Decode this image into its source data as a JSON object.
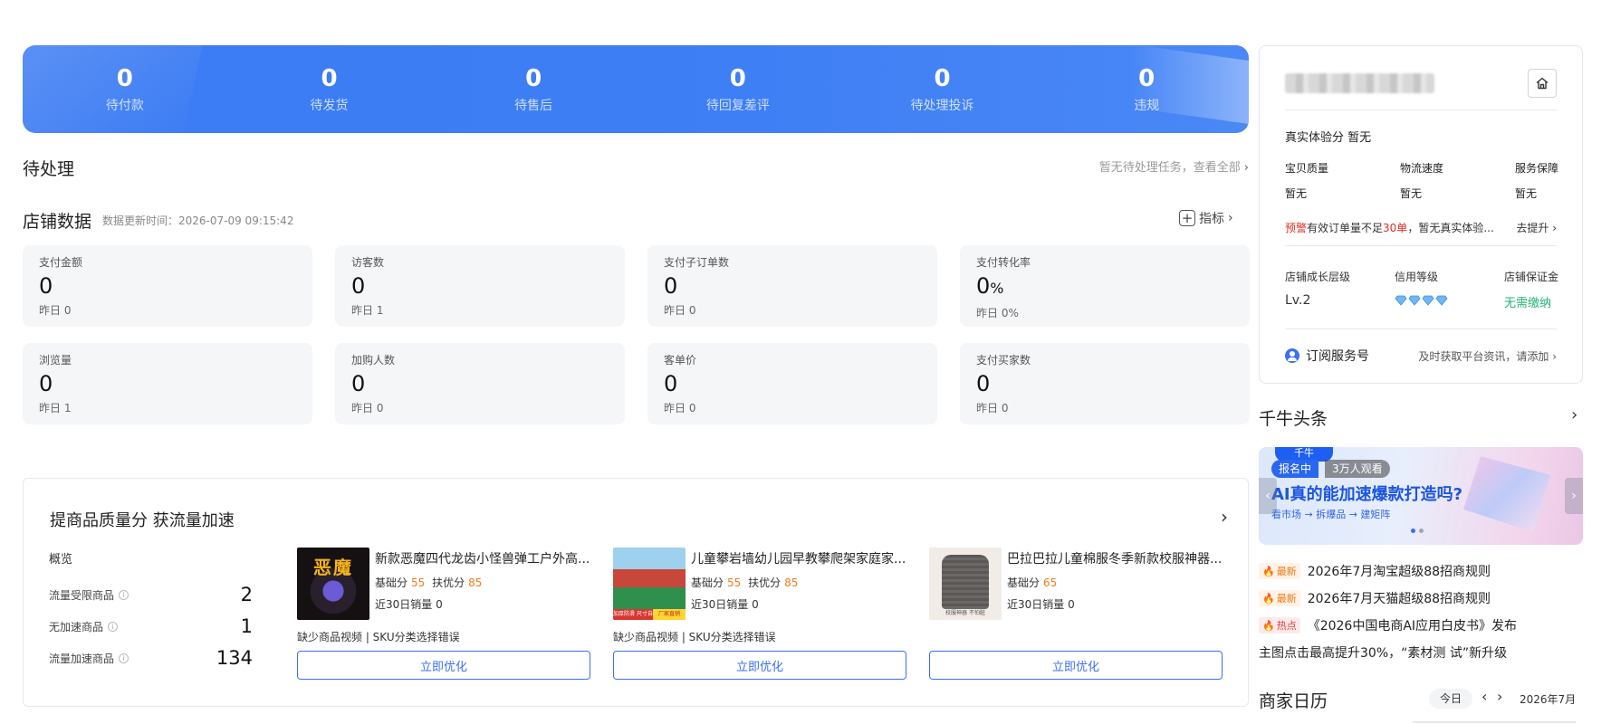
{
  "top_stats": [
    {
      "value": "0",
      "label": "待付款"
    },
    {
      "value": "0",
      "label": "待发货"
    },
    {
      "value": "0",
      "label": "待售后"
    },
    {
      "value": "0",
      "label": "待回复差评"
    },
    {
      "value": "0",
      "label": "待处理投诉"
    },
    {
      "value": "0",
      "label": "违规"
    }
  ],
  "pending": {
    "title": "待处理",
    "link": "暂无待处理任务，查看全部"
  },
  "store_data": {
    "title": "店铺数据",
    "update_time": "数据更新时间：2026-07-09 09:15:42",
    "indicator_label": "指标",
    "metrics": [
      {
        "label": "支付金额",
        "value": "0",
        "unit": "",
        "yesterday": "昨日 0"
      },
      {
        "label": "访客数",
        "value": "0",
        "unit": "",
        "yesterday": "昨日 1"
      },
      {
        "label": "支付子订单数",
        "value": "0",
        "unit": "",
        "yesterday": "昨日 0"
      },
      {
        "label": "支付转化率",
        "value": "0",
        "unit": "%",
        "yesterday": "昨日 0%"
      },
      {
        "label": "浏览量",
        "value": "0",
        "unit": "",
        "yesterday": "昨日 1"
      },
      {
        "label": "加购人数",
        "value": "0",
        "unit": "",
        "yesterday": "昨日 0"
      },
      {
        "label": "客单价",
        "value": "0",
        "unit": "",
        "yesterday": "昨日 0"
      },
      {
        "label": "支付买家数",
        "value": "0",
        "unit": "",
        "yesterday": "昨日 0"
      }
    ]
  },
  "quality": {
    "title": "提商品质量分 获流量加速",
    "overview": "概览",
    "rows": [
      {
        "label": "流量受限商品",
        "value": "2"
      },
      {
        "label": "无加速商品",
        "value": "1"
      },
      {
        "label": "流量加速商品",
        "value": "134"
      }
    ],
    "products": [
      {
        "name": "新款恶魔四代龙齿小怪兽弹工户外高...",
        "base_label": "基础分",
        "base": "55",
        "support_label": "扶优分",
        "support": "85",
        "sales": "近30日销量 0",
        "issue": "缺少商品视频 | SKU分类选择错误",
        "button": "立即优化",
        "thumb_text": "恶魔"
      },
      {
        "name": "儿童攀岩墙幼儿园早教攀爬架家庭家...",
        "base_label": "基础分",
        "base": "55",
        "support_label": "扶优分",
        "support": "85",
        "sales": "近30日销量 0",
        "issue": "缺少商品视频 | SKU分类选择错误",
        "button": "立即优化",
        "thumb_text_a": "加厚防滑 尺寸自选",
        "thumb_text_b": "厂家直销"
      },
      {
        "name": "巴拉巴拉儿童棉服冬季新款校服神器...",
        "base_label": "基础分",
        "base": "65",
        "sales": "近30日销量 0",
        "button": "立即优化",
        "thumb_text": "校服神器 不怕脏"
      }
    ]
  },
  "shop": {
    "experience_title": "真实体验分  暂无",
    "experience": [
      {
        "label": "宝贝质量",
        "value": "暂无"
      },
      {
        "label": "物流速度",
        "value": "暂无"
      },
      {
        "label": "服务保障",
        "value": "暂无"
      }
    ],
    "warning_prefix": "预警",
    "warning_mid": "有效订单量不足",
    "warning_num": "30单",
    "warning_suffix": "，暂无真实体验...",
    "warning_action": "去提升",
    "levels": [
      {
        "label": "店铺成长层级",
        "value": "Lv.2"
      },
      {
        "label": "信用等级",
        "value": ""
      },
      {
        "label": "店铺保证金",
        "value": "无需缴纳"
      }
    ],
    "subscribe_label": "订阅服务号",
    "subscribe_desc": "及时获取平台资讯，请添加"
  },
  "headlines": {
    "title": "千牛头条",
    "banner": {
      "brand": "千牛",
      "tag_status": "报名中",
      "tag_viewers": "3万人观看",
      "headline": "AI真的能加速爆款打造吗?",
      "sub": "看市场 → 拆爆品 → 建矩阵"
    },
    "items": [
      {
        "badge": "最新",
        "type": "new",
        "text": "2026年7月淘宝超级88招商规则"
      },
      {
        "badge": "最新",
        "type": "new",
        "text": "2026年7月天猫超级88招商规则"
      },
      {
        "badge": "热点",
        "type": "hot",
        "text": "《2026中国电商AI应用白皮书》发布"
      }
    ],
    "plain_item": "主图点击最高提升30%，“素材测 试”新升级"
  },
  "calendar": {
    "title": "商家日历",
    "today": "今日",
    "month": "2026年7月"
  }
}
